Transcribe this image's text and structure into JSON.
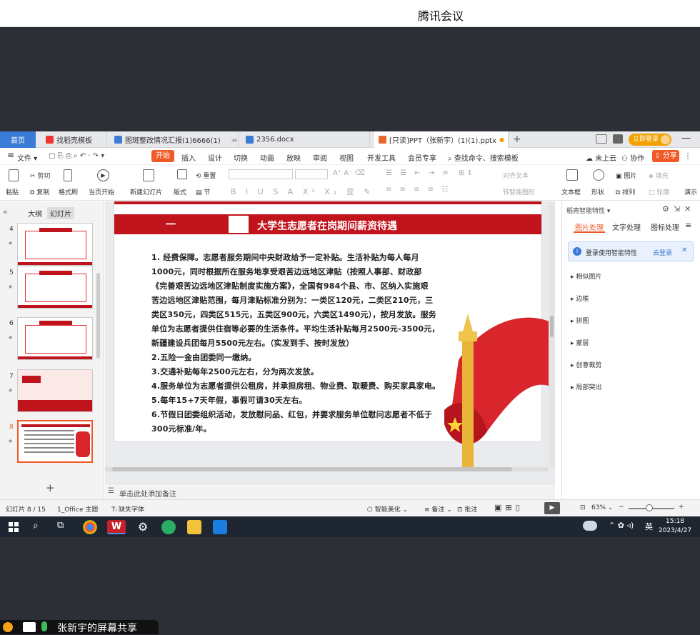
{
  "meeting": {
    "title": "腾讯会议",
    "share_label": "张新宇的屏幕共享"
  },
  "tabs": [
    {
      "label": "首页"
    },
    {
      "label": "找稻壳模板"
    },
    {
      "label": "图斑整改情况汇报(1)6666(1)"
    },
    {
      "label": "2356.docx"
    },
    {
      "label": "[只读]PPT（张新宇）(1)(1).pptx"
    }
  ],
  "tabbar_right": {
    "login": "立即登录"
  },
  "menu": {
    "file": "文件",
    "items": [
      "开始",
      "插入",
      "设计",
      "切换",
      "动画",
      "放映",
      "审阅",
      "视图",
      "开发工具",
      "会员专享"
    ],
    "search": "查找命令、搜索模板",
    "cloud": "未上云",
    "collab": "协作",
    "share": "分享"
  },
  "toolbar": {
    "paste": "粘贴",
    "cut": "剪切",
    "copy": "复制",
    "format_painter": "格式刷",
    "play_from_current": "当页开始",
    "new_slide": "新建幻灯片",
    "layout": "版式",
    "section": "节",
    "reset": "重置",
    "align_text": "对齐文本",
    "smart_shape": "转智能图形",
    "textbox": "文本框",
    "shape": "形状",
    "picture": "图片",
    "fill": "填充",
    "arrange": "排列",
    "outline": "轮廓",
    "demo": "演示"
  },
  "left_pane": {
    "tabs": [
      "大纲",
      "幻灯片"
    ],
    "slides": [
      {
        "num": "4"
      },
      {
        "num": "5"
      },
      {
        "num": "6"
      },
      {
        "num": "7"
      },
      {
        "num": "8"
      }
    ],
    "add": "+"
  },
  "slide": {
    "section_num": "一",
    "title": "大学生志愿者在岗期间薪资待遇",
    "lines": [
      "1. 经费保障。志愿者服务期间中央财政给予一定补贴。生活补贴为每人每月",
      "1000元，同时根据所在服务地享受艰苦边远地区津贴（按照人事部、财政部",
      "《完善艰苦边远地区津贴制度实施方案》，全国有984个县、市、区纳入实施艰",
      "苦边远地区津贴范围，每月津贴标准分别为：一类区120元，二类区210元，三",
      "类区350元，四类区515元，五类区900元，六类区1490元），按月发放。服务",
      "单位为志愿者提供住宿等必要的生活条件。平均生活补贴每月2500元-3500元，",
      "新疆建设兵团每月5500元左右。（实发到手、按时发放）",
      "2.五险一金由团委同一缴纳。",
      "3.交通补贴每年2500元左右，分为两次发放。",
      "4.服务单位为志愿者提供公租房，并承担房租、物业费、取暖费、购买家具家电。",
      "5.每年15+7天年假，事假可请30天左右。",
      "6.节假日团委组织活动，发放慰问品、红包，并要求服务单位慰问志愿者不低于",
      "300元标准/年。"
    ]
  },
  "right_pane": {
    "title": "稻壳智能特性",
    "tabs": [
      "图片处理",
      "文字处理",
      "图标处理"
    ],
    "notice": "登录使用智能特性",
    "login_link": "去登录",
    "items": [
      "相似图片",
      "边框",
      "拼图",
      "蒙层",
      "创意裁剪",
      "局部突出"
    ]
  },
  "notes": {
    "placeholder": "单击此处添加备注"
  },
  "status": {
    "slide_info": "幻灯片 8 / 15",
    "theme": "1_Office 主题",
    "missing_font": "缺失字体",
    "smart_beautify": "智能美化",
    "notes": "备注",
    "comment": "批注",
    "zoom": "63%"
  },
  "taskbar": {
    "ime": "英",
    "time": "15:18",
    "date": "2023/4/27"
  },
  "colors": {
    "accent_red": "#c0141c",
    "wps_orange": "#f05a28",
    "tab_blue": "#3a7bd5"
  }
}
